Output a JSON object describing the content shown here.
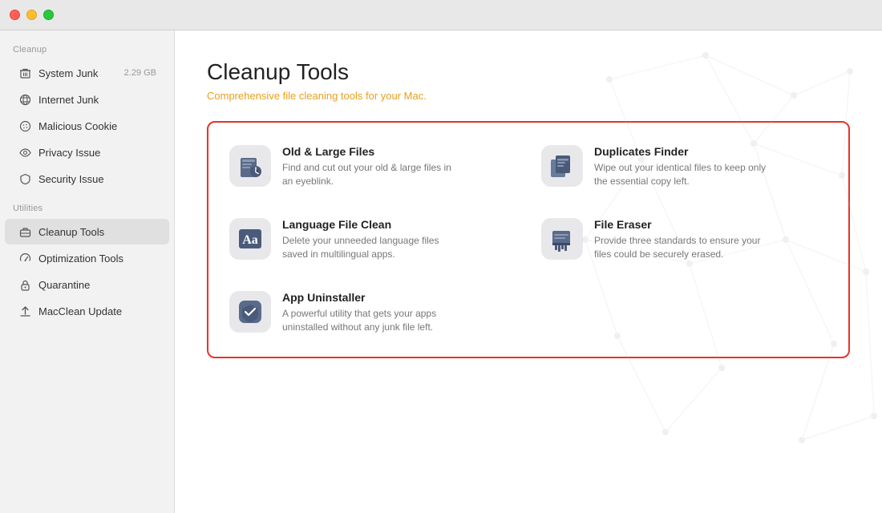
{
  "titlebar": {
    "buttons": [
      "close",
      "minimize",
      "maximize"
    ]
  },
  "sidebar": {
    "cleanup_label": "Cleanup",
    "utilities_label": "Utilities",
    "items_cleanup": [
      {
        "id": "system-junk",
        "label": "System Junk",
        "badge": "2.29 GB",
        "icon": "trash"
      },
      {
        "id": "internet-junk",
        "label": "Internet Junk",
        "badge": "",
        "icon": "globe"
      },
      {
        "id": "malicious-cookie",
        "label": "Malicious Cookie",
        "badge": "",
        "icon": "cookie"
      },
      {
        "id": "privacy-issue",
        "label": "Privacy Issue",
        "badge": "",
        "icon": "eye"
      },
      {
        "id": "security-issue",
        "label": "Security Issue",
        "badge": "",
        "icon": "shield"
      }
    ],
    "items_utilities": [
      {
        "id": "cleanup-tools",
        "label": "Cleanup Tools",
        "icon": "briefcase",
        "active": true
      },
      {
        "id": "optimization-tools",
        "label": "Optimization Tools",
        "icon": "gauge"
      },
      {
        "id": "quarantine",
        "label": "Quarantine",
        "icon": "lock"
      },
      {
        "id": "macclean-update",
        "label": "MacClean Update",
        "icon": "arrow-up"
      }
    ]
  },
  "main": {
    "title": "Cleanup Tools",
    "subtitle": "Comprehensive file cleaning tools for your Mac.",
    "tools": [
      {
        "id": "old-large-files",
        "name": "Old & Large Files",
        "desc": "Find and cut out your old & large files in an eyeblink.",
        "icon": "old-files-icon"
      },
      {
        "id": "duplicates-finder",
        "name": "Duplicates Finder",
        "desc": "Wipe out your identical files to keep only the essential copy left.",
        "icon": "duplicates-icon"
      },
      {
        "id": "language-file-clean",
        "name": "Language File Clean",
        "desc": "Delete your unneeded language files saved in multilingual apps.",
        "icon": "language-icon"
      },
      {
        "id": "file-eraser",
        "name": "File Eraser",
        "desc": "Provide three standards to ensure your files could be securely erased.",
        "icon": "eraser-icon"
      },
      {
        "id": "app-uninstaller",
        "name": "App Uninstaller",
        "desc": "A powerful utility that gets your apps uninstalled without any junk file left.",
        "icon": "uninstaller-icon"
      }
    ]
  }
}
